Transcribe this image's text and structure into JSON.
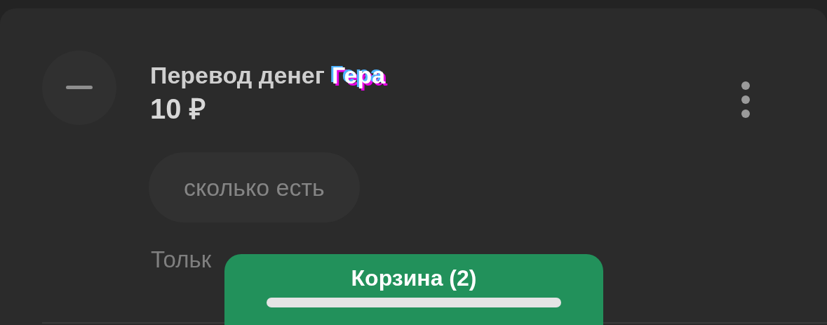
{
  "item": {
    "title": "Перевод денег",
    "recipient": "Гера",
    "amount": "10 ₽"
  },
  "chip": {
    "label": "сколько есть",
    "selected": false
  },
  "note": "Тольк",
  "cart_button": {
    "label": "Корзина (2)"
  }
}
